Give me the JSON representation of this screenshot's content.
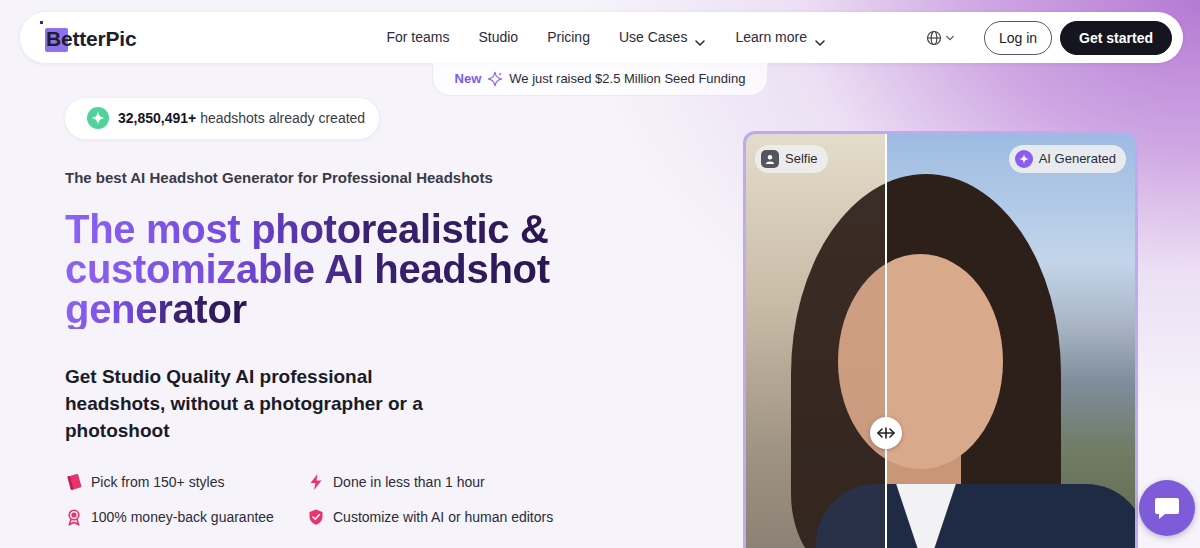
{
  "navbar": {
    "logo": "BetterPic",
    "links": [
      {
        "label": "For teams",
        "dropdown": false
      },
      {
        "label": "Studio",
        "dropdown": false
      },
      {
        "label": "Pricing",
        "dropdown": false
      },
      {
        "label": "Use Cases",
        "dropdown": true
      },
      {
        "label": "Learn more",
        "dropdown": true
      }
    ],
    "login": "Log in",
    "cta": "Get started"
  },
  "announcement": {
    "badge": "New",
    "text": "We just raised $2.5 Million Seed Funding"
  },
  "stats": {
    "count": "32,850,491+",
    "label": "headshots already created"
  },
  "tagline": "The best AI Headshot Generator for Professional Headshots",
  "headline": [
    "The most photorealistic &",
    "customizable AI headshot",
    "generator"
  ],
  "subheadline": "Get Studio Quality AI professional headshots, without a photographer or a photoshoot",
  "features": [
    {
      "label": "Pick from 150+ styles"
    },
    {
      "label": "Done in less than 1 hour"
    },
    {
      "label": "100% money-back guarantee"
    },
    {
      "label": "Customize with AI or human editors"
    }
  ],
  "comparison": {
    "before_label": "Selfie",
    "after_label": "AI Generated",
    "level": 0.36
  }
}
